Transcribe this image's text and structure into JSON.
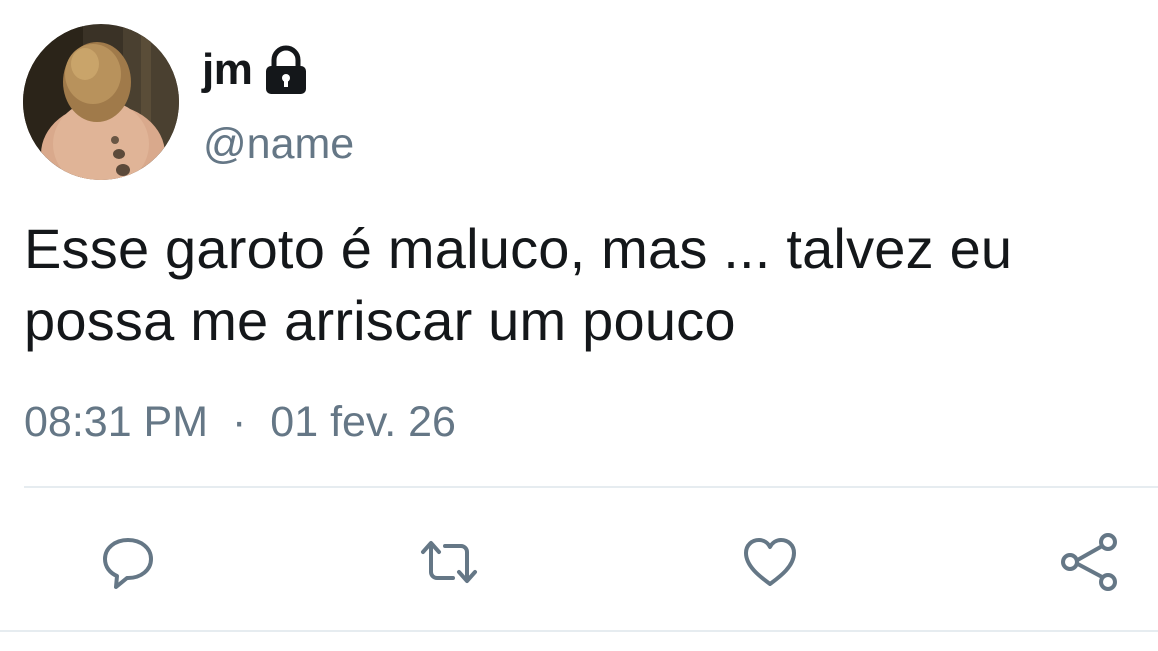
{
  "tweet": {
    "display_name": "jm",
    "handle": "@name",
    "text": "Esse garoto é maluco, mas ... talvez eu possa me arriscar um pouco",
    "time": "08:31 PM",
    "separator": "·",
    "date": "01 fev. 26"
  },
  "icons": {
    "protected": "lock-icon",
    "reply": "speech-bubble-icon",
    "retweet": "retweet-arrows-icon",
    "like": "heart-icon",
    "share": "share-nodes-icon"
  },
  "colors": {
    "text_primary": "#14171a",
    "text_secondary": "#657786",
    "divider": "#e6ecf0",
    "background": "#ffffff"
  }
}
